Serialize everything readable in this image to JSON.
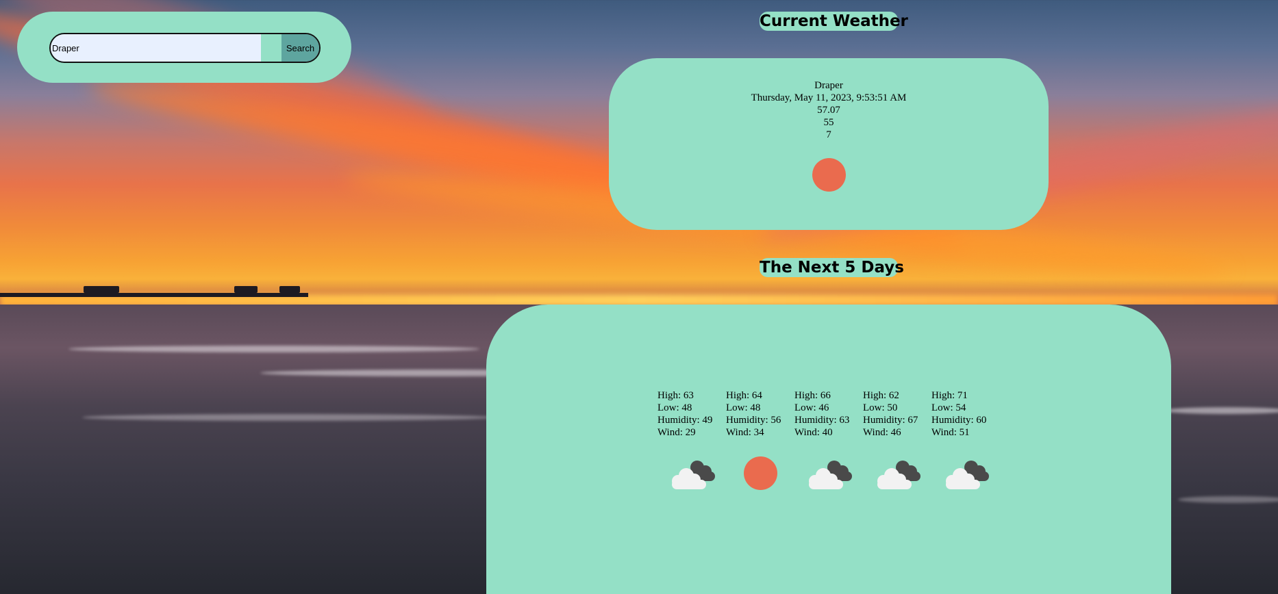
{
  "search": {
    "value": "Draper",
    "button_label": "Search"
  },
  "current": {
    "heading": "Current Weather",
    "city": "Draper",
    "datetime": "Thursday, May 11, 2023, 9:53:51 AM",
    "temp": "57.07",
    "humidity": "55",
    "wind": "7",
    "icon": "sun-icon"
  },
  "forecast": {
    "heading": "The Next 5 Days",
    "days": [
      {
        "high": "High: 63",
        "low": "Low: 48",
        "humidity": "Humidity: 49",
        "wind": "Wind: 29",
        "icon": "cloud-icon"
      },
      {
        "high": "High: 64",
        "low": "Low: 48",
        "humidity": "Humidity: 56",
        "wind": "Wind: 34",
        "icon": "sun-icon"
      },
      {
        "high": "High: 66",
        "low": "Low: 46",
        "humidity": "Humidity: 63",
        "wind": "Wind: 40",
        "icon": "cloud-icon"
      },
      {
        "high": "High: 62",
        "low": "Low: 50",
        "humidity": "Humidity: 67",
        "wind": "Wind: 46",
        "icon": "cloud-icon"
      },
      {
        "high": "High: 71",
        "low": "Low: 54",
        "humidity": "Humidity: 60",
        "wind": "Wind: 51",
        "icon": "cloud-icon"
      }
    ]
  },
  "colors": {
    "panel": "#94e0c6",
    "button": "#5ea59f",
    "sun": "#ea6b4e",
    "input_bg": "#e8f0fe"
  }
}
